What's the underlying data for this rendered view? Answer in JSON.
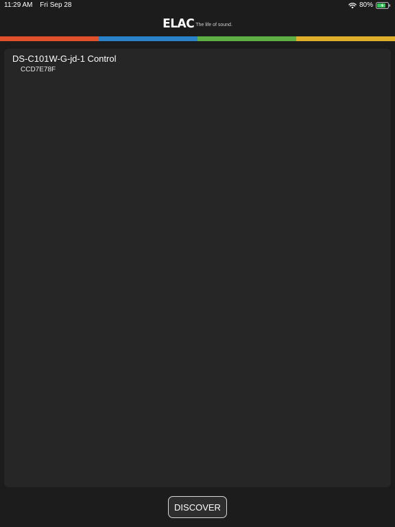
{
  "status_bar": {
    "time": "11:29 AM",
    "date": "Fri Sep 28",
    "battery_percent": "80%",
    "battery_level": 0.8,
    "battery_color": "#34c759"
  },
  "header": {
    "logo": "ELAC",
    "tagline": "The life of sound."
  },
  "stripe_colors": [
    "#e0502a",
    "#2a82c8",
    "#5fae44",
    "#dfae2a"
  ],
  "devices": [
    {
      "name": "DS-C101W-G-jd-1 Control",
      "id": "CCD7E78F"
    }
  ],
  "actions": {
    "discover_label": "DISCOVER"
  }
}
